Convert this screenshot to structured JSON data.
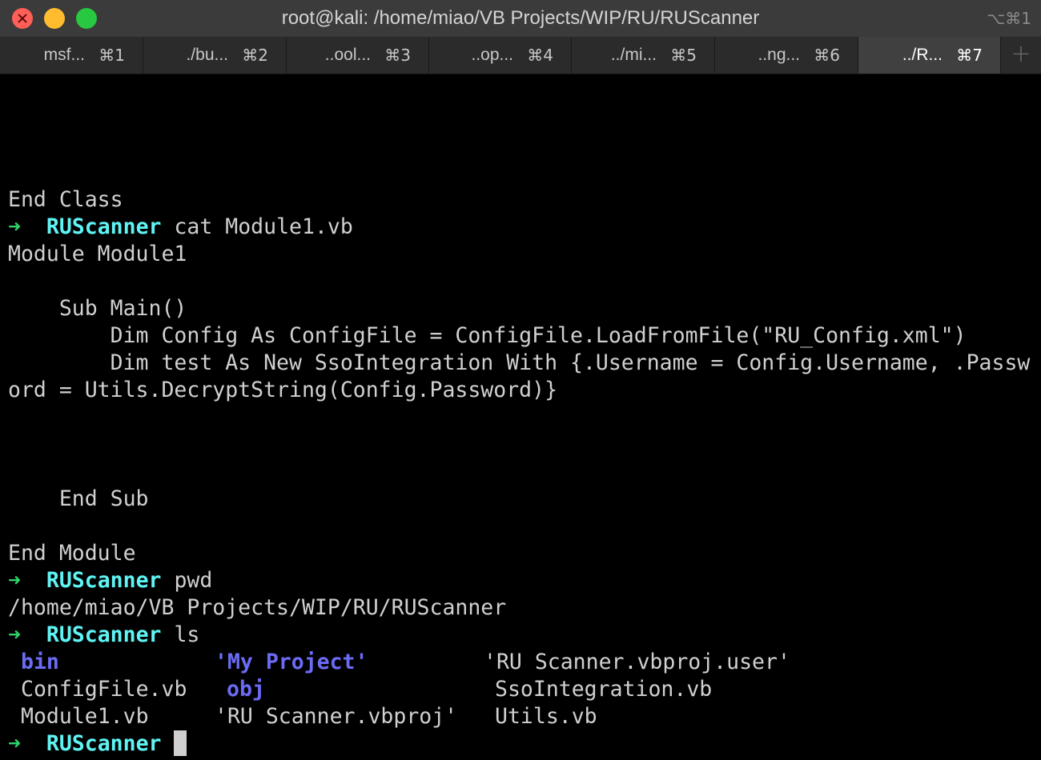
{
  "window": {
    "title": "root@kali: /home/miao/VB Projects/WIP/RU/RUScanner",
    "shortcut": "⌥⌘1"
  },
  "tabs": [
    {
      "label": "msf...",
      "shortcut": "⌘1",
      "active": false
    },
    {
      "label": "./bu...",
      "shortcut": "⌘2",
      "active": false
    },
    {
      "label": "..ool...",
      "shortcut": "⌘3",
      "active": false
    },
    {
      "label": "..op...",
      "shortcut": "⌘4",
      "active": false
    },
    {
      "label": "../mi...",
      "shortcut": "⌘5",
      "active": false
    },
    {
      "label": "..ng...",
      "shortcut": "⌘6",
      "active": false
    },
    {
      "label": "../R...",
      "shortcut": "⌘7",
      "active": true
    }
  ],
  "new_tab_icon": "+",
  "prompt": {
    "arrow": "➜",
    "dir": "RUScanner"
  },
  "terminal": {
    "end_class": "End Class",
    "cmd_cat": "cat Module1.vb",
    "module_line": "Module Module1",
    "sub_main": "    Sub Main()",
    "dim_config": "        Dim Config As ConfigFile = ConfigFile.LoadFromFile(\"RU_Config.xml\")",
    "dim_test": "        Dim test As New SsoIntegration With {.Username = Config.Username, .Passw",
    "dim_test_wrap": "ord = Utils.DecryptString(Config.Password)}",
    "end_sub": "    End Sub",
    "end_module": "End Module",
    "cmd_pwd": "pwd",
    "pwd_output": "/home/miao/VB Projects/WIP/RU/RUScanner",
    "cmd_ls": "ls"
  },
  "ls_output": {
    "row1": [
      "bin",
      "'My Project'",
      "'RU Scanner.vbproj.user'"
    ],
    "row2": [
      "ConfigFile.vb",
      "obj",
      "SsoIntegration.vb"
    ],
    "row3": [
      "Module1.vb",
      "'RU Scanner.vbproj'",
      "Utils.vb"
    ]
  },
  "colors": {
    "prompt_arrow": "#2ed36a",
    "prompt_dir": "#5ff4f4",
    "directory": "#6b6bf5",
    "text": "#d0d0d0"
  }
}
